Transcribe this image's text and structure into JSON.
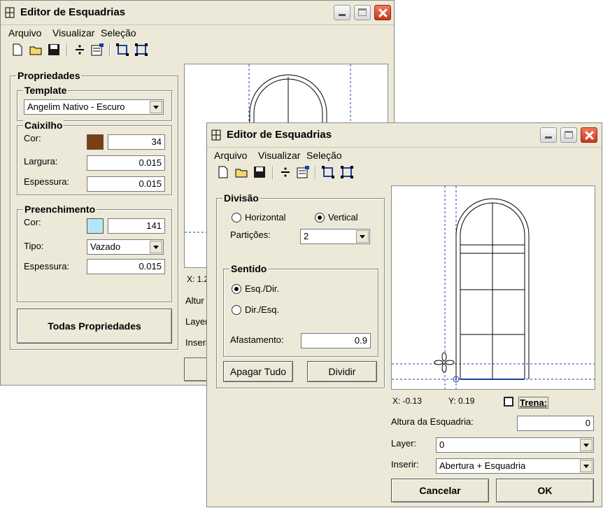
{
  "back_window": {
    "title": "Editor de Esquadrias",
    "menu": [
      "Arquivo",
      "Visualizar",
      "Seleção"
    ],
    "properties_group": "Propriedades",
    "template_group": "Template",
    "template_value": "Angelim Nativo - Escuro",
    "caixilho_group": "Caixilho",
    "caixilho_cor_label": "Cor:",
    "caixilho_cor_value": "34",
    "caixilho_color": "#7b3f12",
    "largura_label": "Largura:",
    "largura_value": "0.015",
    "espessura_label": "Espessura:",
    "espessura_value": "0.015",
    "preenchimento_group": "Preenchimento",
    "preench_cor_label": "Cor:",
    "preench_cor_value": "141",
    "preench_color": "#b5e6f5",
    "tipo_label": "Tipo:",
    "tipo_value": "Vazado",
    "preench_espessura_label": "Espessura:",
    "preench_espessura_value": "0.015",
    "todas_propriedades": "Todas Propriedades",
    "coord_x_partial": "X: 1.2",
    "altura_partial": "Altur",
    "layer_partial": "Layer",
    "inserir_partial": "Inseri"
  },
  "front_window": {
    "title": "Editor de Esquadrias",
    "menu": [
      "Arquivo",
      "Visualizar",
      "Seleção"
    ],
    "divisao_group": "Divisão",
    "horizontal_label": "Horizontal",
    "vertical_label": "Vertical",
    "particoes_label": "Partições:",
    "particoes_value": "2",
    "sentido_group": "Sentido",
    "esq_dir_label": "Esq./Dir.",
    "dir_esq_label": "Dir./Esq.",
    "afastamento_label": "Afastamento:",
    "afastamento_value": "0.9",
    "apagar_tudo": "Apagar Tudo",
    "dividir": "Dividir",
    "coord_x": "X: -0.13",
    "coord_y": "Y: 0.19",
    "trena_label": "Trena:",
    "altura_label": "Altura da Esquadria:",
    "altura_value": "0",
    "layer_label": "Layer:",
    "layer_value": "0",
    "inserir_label": "Inserir:",
    "inserir_value": "Abertura + Esquadria",
    "cancelar": "Cancelar",
    "ok": "OK"
  },
  "icons": [
    "window-app-icon",
    "new-file-icon",
    "open-folder-icon",
    "save-icon",
    "divide-icon",
    "properties-icon",
    "select-frame-icon",
    "select-nodes-icon",
    "minimize-icon",
    "maximize-icon",
    "close-icon"
  ]
}
